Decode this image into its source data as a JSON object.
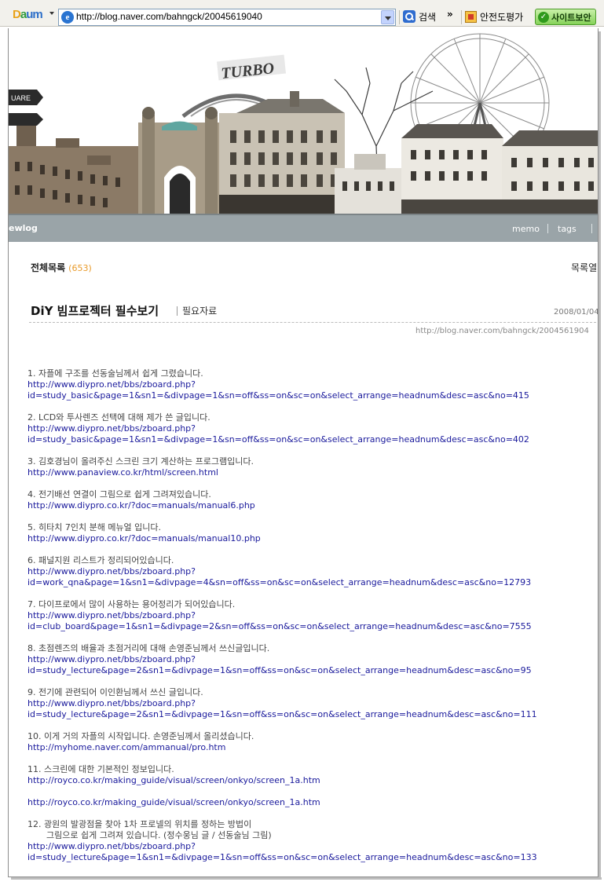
{
  "toolbar": {
    "logo_parts": [
      "D",
      "a",
      "um"
    ],
    "address_url": "http://blog.naver.com/bahngck/20045619040",
    "search_label": "검색",
    "more_label": "»",
    "safety_label": "안전도평가",
    "secure_label": "사이트보안"
  },
  "banner": {
    "sign_text": "TURBO",
    "street_sign": "UARE"
  },
  "blog_nav": {
    "brand": "ewlog",
    "memo": "memo",
    "tags": "tags"
  },
  "post_list": {
    "title": "전체목록",
    "count": "(653)",
    "toggle": "목록열"
  },
  "post": {
    "title": "DiY 빔프로젝터 필수보기",
    "category": "필요자료",
    "date": "2008/01/04",
    "permalink": "http://blog.naver.com/bahngck/2004561904"
  },
  "items": [
    {
      "text": "1. 자플에 구조를 선동술님께서 쉽게 그렸습니다.",
      "links": [
        "http://www.diypro.net/bbs/zboard.php?",
        "id=study_basic&page=1&sn1=&divpage=1&sn=off&ss=on&sc=on&select_arrange=headnum&desc=asc&no=415"
      ]
    },
    {
      "text": "2. LCD와 투사렌즈 선택에 대해 제가 쓴 글입니다.",
      "links": [
        "http://www.diypro.net/bbs/zboard.php?",
        "id=study_basic&page=1&sn1=&divpage=1&sn=off&ss=on&sc=on&select_arrange=headnum&desc=asc&no=402"
      ]
    },
    {
      "text": "3. 김호경님이 올려주신 스크린 크기 계산하는 프로그램입니다.",
      "links": [
        "http://www.panaview.co.kr/html/screen.html"
      ]
    },
    {
      "text": "4. 전기배선 연결이 그림으로 쉽게 그려져있습니다.",
      "links": [
        "http://www.diypro.co.kr/?doc=manuals/manual6.php"
      ]
    },
    {
      "text": "5. 히타치 7인치 분해 메뉴얼 입니다.",
      "links": [
        "http://www.diypro.co.kr/?doc=manuals/manual10.php"
      ]
    },
    {
      "text": "6. 패널지원 리스트가 정리되어있습니다.",
      "links": [
        "http://www.diypro.net/bbs/zboard.php?",
        "id=work_qna&page=1&sn1=&divpage=4&sn=off&ss=on&sc=on&select_arrange=headnum&desc=asc&no=12793"
      ]
    },
    {
      "text": "7. 다이프로에서 많이 사용하는 용어정리가 되어있습니다.",
      "links": [
        "http://www.diypro.net/bbs/zboard.php?",
        "id=club_board&page=1&sn1=&divpage=2&sn=off&ss=on&sc=on&select_arrange=headnum&desc=asc&no=7555"
      ]
    },
    {
      "text": "8. 초점렌즈의 배율과 초점거리에 대해 손영준님께서 쓰신글입니다.",
      "links": [
        "http://www.diypro.net/bbs/zboard.php?",
        "id=study_lecture&page=2&sn1=&divpage=1&sn=off&ss=on&sc=on&select_arrange=headnum&desc=asc&no=95"
      ]
    },
    {
      "text": "9. 전기에 관련되어 이인환님께서 쓰신 글입니다.",
      "links": [
        "http://www.diypro.net/bbs/zboard.php?",
        "id=study_lecture&page=2&sn1=&divpage=1&sn=off&ss=on&sc=on&select_arrange=headnum&desc=asc&no=111"
      ]
    },
    {
      "text": "10. 이게 거의 자플의 시작입니다. 손영준님께서 올리셨습니다.",
      "links": [
        "http://myhome.naver.com/ammanual/pro.htm"
      ]
    },
    {
      "text": "11. 스크린에 대한 기본적인 정보입니다.",
      "links": [
        "http://royco.co.kr/making_guide/visual/screen/onkyo/screen_1a.htm",
        "",
        "http://royco.co.kr/making_guide/visual/screen/onkyo/screen_1a.htm"
      ]
    },
    {
      "text": "12. 광원의 발광점을 찾아 1차 프로넬의 위치를 정하는 방법이",
      "indent": "그림으로 쉽게 그려져 있습니다. (정수웅님 글 / 선동술님 그림)",
      "links": [
        "http://www.diypro.net/bbs/zboard.php?",
        "id=study_lecture&page=1&sn1=&divpage=1&sn=off&ss=on&sc=on&select_arrange=headnum&desc=asc&no=133"
      ]
    }
  ],
  "colors": {
    "nav_bar": "#9aa4a8",
    "link": "#1a1a9c",
    "count": "#e89a2a"
  }
}
